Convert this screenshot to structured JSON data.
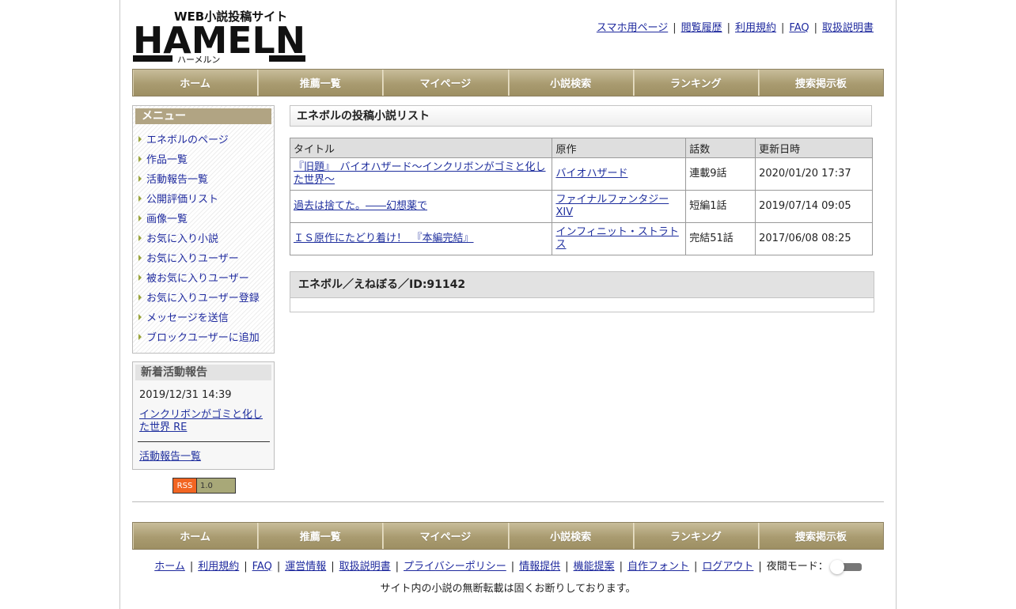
{
  "header": {
    "logo_text": "HAMELN",
    "logo_sub_top": "WEB小説投稿サイト",
    "logo_sub_bottom": "ハーメルン",
    "links": [
      "スマホ用ページ",
      "閲覧履歴",
      "利用規約",
      "FAQ",
      "取扱説明書"
    ]
  },
  "nav": [
    "ホーム",
    "推薦一覧",
    "マイページ",
    "小説検索",
    "ランキング",
    "捜索掲示板"
  ],
  "sidebar": {
    "menu_title": "メニュー",
    "menu_items": [
      "エネボルのページ",
      "作品一覧",
      "活動報告一覧",
      "公開評価リスト",
      "画像一覧",
      "お気に入り小説",
      "お気に入りユーザー",
      "被お気に入りユーザー",
      "お気に入りユーザー登録",
      "メッセージを送信",
      "ブロックユーザーに追加"
    ],
    "activity_title": "新着活動報告",
    "activity_date": "2019/12/31 14:39",
    "activity_link": "インクリボンがゴミと化した世界 RE",
    "activity_all": "活動報告一覧",
    "rss_left": "RSS",
    "rss_right": "1.0"
  },
  "main": {
    "title": "エネボルの投稿小説リスト",
    "columns": [
      "タイトル",
      "原作",
      "話数",
      "更新日時"
    ],
    "rows": [
      {
        "title": "『旧題』　バイオハザード～インクリボンがゴミと化した世界～",
        "origin": "バイオハザード",
        "episodes": "連載9話",
        "updated": "2020/01/20 17:37"
      },
      {
        "title": "過去は捨てた。――幻想薬で",
        "origin": "ファイナルファンタジーXIV",
        "episodes": "短編1話",
        "updated": "2019/07/14 09:05"
      },
      {
        "title": "ＩＳ原作にたどり着け！　『本編完結』",
        "origin": "インフィニット・ストラトス",
        "episodes": "完結51話",
        "updated": "2017/06/08 08:25"
      }
    ],
    "author_line": "エネボル／えねぼる／ID:91142"
  },
  "footer": {
    "links": [
      "ホーム",
      "利用規約",
      "FAQ",
      "運営情報",
      "取扱説明書",
      "プライバシーポリシー",
      "情報提供",
      "機能提案",
      "自作フォント",
      "ログアウト"
    ],
    "night_mode_label": "夜間モード：",
    "notice": "サイト内の小説の無断転載は固くお断りしております。"
  },
  "colors": {
    "nav_bg": "#a99b70",
    "menu_head_bg": "#b1a483",
    "link": "#1f2a9e"
  }
}
